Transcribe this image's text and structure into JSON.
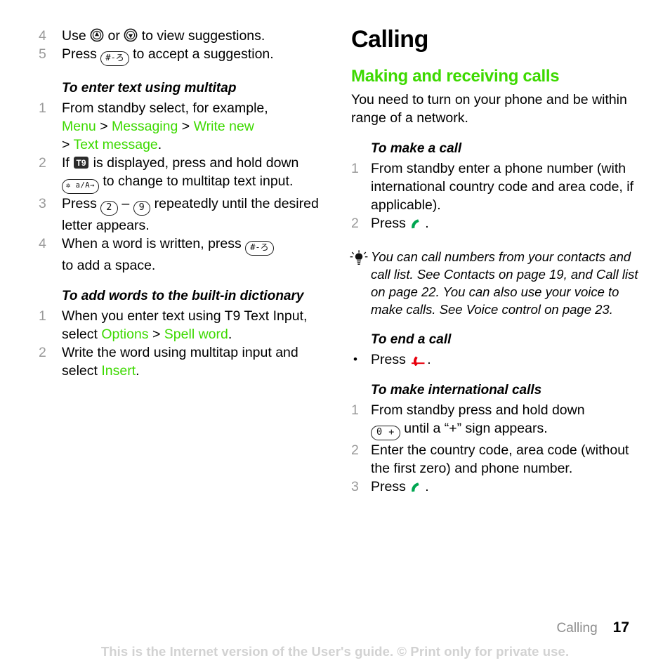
{
  "meta": {
    "accent_green": "#3DD900",
    "step_number_gray": "#9A9A9A",
    "call_green": "#00A651",
    "end_call_red": "#E8000D",
    "footer_gray": "#D2D2D2"
  },
  "left_column": {
    "continued_steps": [
      {
        "num": "4",
        "parts": [
          {
            "type": "text",
            "value": "Use "
          },
          {
            "type": "icon",
            "icon": "nav-up-key-icon"
          },
          {
            "type": "text",
            "value": " or "
          },
          {
            "type": "icon",
            "icon": "nav-down-key-icon"
          },
          {
            "type": "text",
            "value": " to view suggestions."
          }
        ]
      },
      {
        "num": "5",
        "parts": [
          {
            "type": "text",
            "value": "Press "
          },
          {
            "type": "key",
            "label": "#-ろ"
          },
          {
            "type": "text",
            "value": " to accept a suggestion."
          }
        ]
      }
    ],
    "procedures": [
      {
        "heading": "To enter text using multitap",
        "list_type": "ordered",
        "steps": [
          {
            "num": "1",
            "text_lead": "From standby select, for example,",
            "path": [
              "Menu",
              "Messaging",
              "Write new",
              "Text message"
            ]
          },
          {
            "num": "2",
            "text_a": "If ",
            "badge": "T9",
            "text_b": " is displayed, press and hold down",
            "key": "✲ a/A→",
            "text_c": " to change to multitap text input."
          },
          {
            "num": "3",
            "text_a": "Press ",
            "key_from": "2",
            "dash": " – ",
            "key_to": "9",
            "text_b": " repeatedly until the desired letter appears."
          },
          {
            "num": "4",
            "text_a": "When a word is written, press ",
            "key": "#-ろ",
            "text_b": " to add a space."
          }
        ]
      },
      {
        "heading": "To add words to the built-in dictionary",
        "list_type": "ordered",
        "steps": [
          {
            "num": "1",
            "text_a": "When you enter text using T9 Text Input, select ",
            "link_a": "Options",
            "sep": " > ",
            "link_b": "Spell word",
            "text_b": "."
          },
          {
            "num": "2",
            "text_a": "Write the word using multitap input and select ",
            "link_a": "Insert",
            "text_b": "."
          }
        ]
      }
    ]
  },
  "right_column": {
    "chapter_title": "Calling",
    "section_heading": "Making and receiving calls",
    "section_intro": "You need to turn on your phone and be within range of a network.",
    "procedures": [
      {
        "heading": "To make a call",
        "steps": [
          {
            "num": "1",
            "text": "From standby enter a phone number (with international country code and area code, if applicable)."
          },
          {
            "num": "2",
            "text_a": "Press ",
            "icon": "call-green-icon",
            "text_b": "."
          }
        ]
      }
    ],
    "tip": {
      "icon": "lightbulb-tip-icon",
      "text": "You can call numbers from your contacts and call list. See Contacts on page 19, and Call list on page 22. You can also use your voice to make calls. See Voice control on page 23."
    },
    "procedure_end_call": {
      "heading": "To end a call",
      "bullet": "•",
      "text_a": "Press ",
      "icon": "end-call-red-icon",
      "text_b": "."
    },
    "procedure_international": {
      "heading": "To make international calls",
      "steps": [
        {
          "num": "1",
          "text_a": "From standby press and hold down ",
          "key": "0 +",
          "text_b": " until a “+” sign appears."
        },
        {
          "num": "2",
          "text": "Enter the country code, area code (without the first zero) and phone number."
        },
        {
          "num": "3",
          "text_a": "Press ",
          "icon": "call-green-icon",
          "text_b": "."
        }
      ]
    }
  },
  "footer": {
    "chapter": "Calling",
    "page_number": "17",
    "notice": "This is the Internet version of the User's guide. © Print only for private use."
  }
}
